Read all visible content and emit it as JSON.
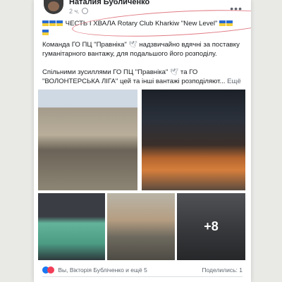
{
  "post": {
    "author": "Наталия Бубличенко",
    "time": "2 ч.",
    "line1": "ЧЕСТЬ І ХВАЛА  Rotary Club Kharkiw \"New Level\"",
    "line2a": "Команда ГО ПЦ \"Правніка\"",
    "line2b": "надзвичайно вдячні за поставку гуманітарного вантажу, для подальшого його розподілу.",
    "line3a": "Спільними зусиллями ГО ПЦ \"Правніка\"",
    "line3b": "та ГО \"ВОЛОНТЕРСЬКА ЛІГА\" цей та інші вантажі розподіляют...",
    "see_more": "Ещё"
  },
  "photos": {
    "more_count": "+8"
  },
  "footer": {
    "reactions": "Вы, Вікторія Бубліченко и ещё 5",
    "shares": "Поделились: 1"
  },
  "icons": {
    "flag": "ukraine-flag-icon",
    "dove": "dove-icon",
    "globe": "globe-icon",
    "like": "like-icon",
    "heart": "heart-icon"
  },
  "colors": {
    "highlight": "#e07b84",
    "link": "#1877f2"
  }
}
